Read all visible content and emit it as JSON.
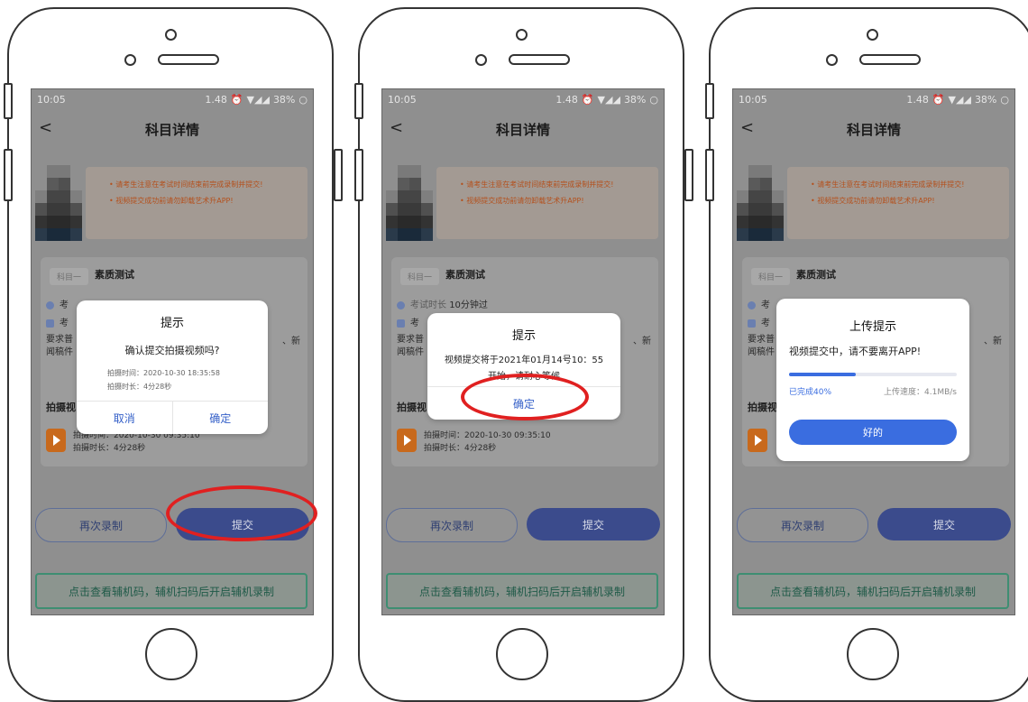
{
  "status_bar": {
    "time": "10:05",
    "speed": "1.48",
    "battery": "38%"
  },
  "nav": {
    "back_icon": "chevron-left-icon",
    "title": "科目详情"
  },
  "notice": {
    "line1": "• 请考生注意在考试时间结束前完成录制并提交!",
    "line2": "• 视频提交成功前请勿卸载艺术升APP!"
  },
  "subject": {
    "tag": "科目一",
    "name": "素质测试",
    "duration_label": "考试时长",
    "duration_value": "10分钟过",
    "exam_prefix": "考",
    "req_prefix": "要求普",
    "req_suffix": "、新",
    "req_line2": "闻稿件"
  },
  "video": {
    "title": "拍摄视",
    "title_partial": "拍摄视",
    "time_line": "拍摄时间：2020-10-30 09:35:10",
    "length_line": "拍摄时长：4分28秒"
  },
  "buttons": {
    "rerecord": "再次录制",
    "submit": "提交",
    "aux": "点击查看辅机码，辅机扫码后开启辅机录制"
  },
  "dialog1": {
    "title": "提示",
    "message": "确认提交拍摄视频吗?",
    "time_line": "拍摄时间：2020-10-30 18:35:58",
    "length_line": "拍摄时长：4分28秒",
    "cancel": "取消",
    "confirm": "确定"
  },
  "dialog2": {
    "title": "提示",
    "line1": "视频提交将于2021年01月14号10：55",
    "line2": "开始，请耐心等候",
    "confirm": "确定"
  },
  "dialog3": {
    "title": "上传提示",
    "message": "视频提交中，请不要离开APP!",
    "progress_label": "已完成40%",
    "progress": 0.4,
    "speed": "上传速度：4.1MB/s",
    "ok": "好的"
  },
  "colors": {
    "primary": "#3a6de0",
    "highlight": "#e02020",
    "warning": "#c8691c"
  }
}
